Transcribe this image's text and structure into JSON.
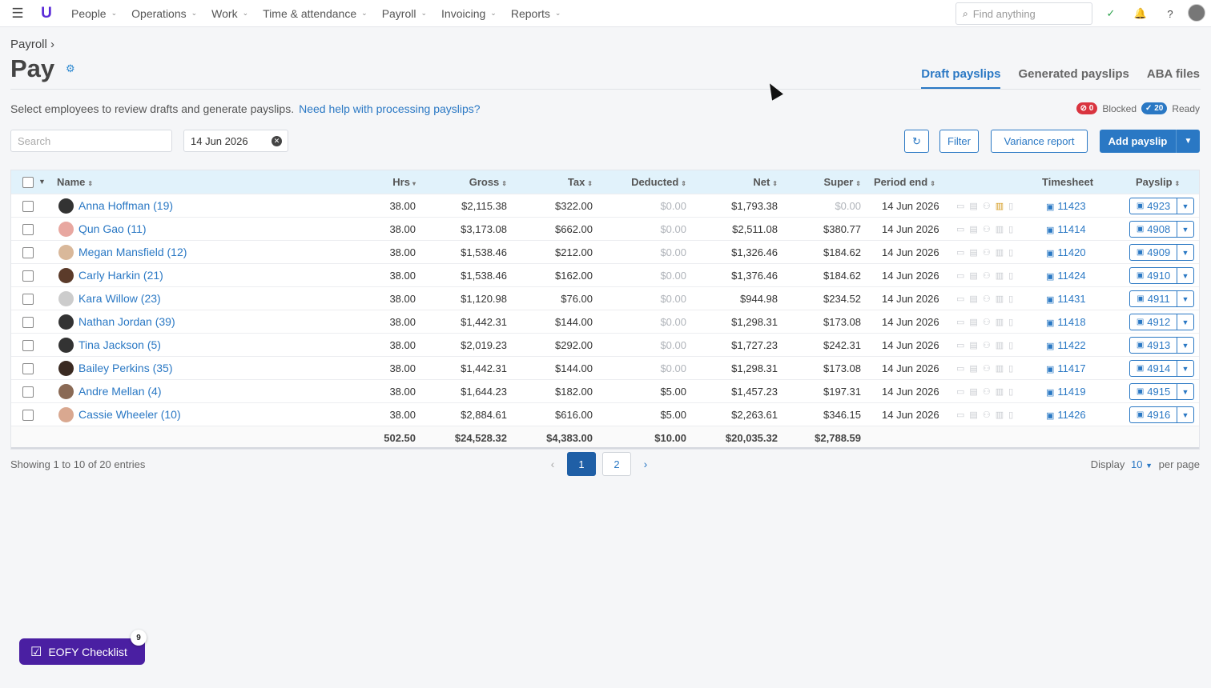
{
  "nav": {
    "items": [
      "People",
      "Operations",
      "Work",
      "Time & attendance",
      "Payroll",
      "Invoicing",
      "Reports"
    ],
    "search_placeholder": "Find anything"
  },
  "breadcrumb": "Payroll",
  "title": "Pay",
  "tabs": [
    "Draft payslips",
    "Generated payslips",
    "ABA files"
  ],
  "intro": "Select employees to review drafts and generate payslips.",
  "help_link": "Need help with processing payslips?",
  "status": {
    "blocked_count": "0",
    "blocked_label": "Blocked",
    "ready_count": "20",
    "ready_label": "Ready"
  },
  "toolbar": {
    "search_placeholder": "Search",
    "date": "14 Jun 2026",
    "filter": "Filter",
    "variance": "Variance report",
    "add": "Add payslip"
  },
  "columns": {
    "name": "Name",
    "hrs": "Hrs",
    "gross": "Gross",
    "tax": "Tax",
    "deducted": "Deducted",
    "net": "Net",
    "super": "Super",
    "period": "Period end",
    "timesheet": "Timesheet",
    "payslip": "Payslip"
  },
  "rows": [
    {
      "name": "Anna Hoffman (19)",
      "hrs": "38.00",
      "gross": "$2,115.38",
      "tax": "$322.00",
      "deducted": "$0.00",
      "net": "$1,793.38",
      "super": "$0.00",
      "period": "14 Jun 2026",
      "timesheet": "11423",
      "payslip": "4923"
    },
    {
      "name": "Qun Gao (11)",
      "hrs": "38.00",
      "gross": "$3,173.08",
      "tax": "$662.00",
      "deducted": "$0.00",
      "net": "$2,511.08",
      "super": "$380.77",
      "period": "14 Jun 2026",
      "timesheet": "11414",
      "payslip": "4908"
    },
    {
      "name": "Megan Mansfield (12)",
      "hrs": "38.00",
      "gross": "$1,538.46",
      "tax": "$212.00",
      "deducted": "$0.00",
      "net": "$1,326.46",
      "super": "$184.62",
      "period": "14 Jun 2026",
      "timesheet": "11420",
      "payslip": "4909"
    },
    {
      "name": "Carly Harkin (21)",
      "hrs": "38.00",
      "gross": "$1,538.46",
      "tax": "$162.00",
      "deducted": "$0.00",
      "net": "$1,376.46",
      "super": "$184.62",
      "period": "14 Jun 2026",
      "timesheet": "11424",
      "payslip": "4910"
    },
    {
      "name": "Kara Willow (23)",
      "hrs": "38.00",
      "gross": "$1,120.98",
      "tax": "$76.00",
      "deducted": "$0.00",
      "net": "$944.98",
      "super": "$234.52",
      "period": "14 Jun 2026",
      "timesheet": "11431",
      "payslip": "4911"
    },
    {
      "name": "Nathan Jordan (39)",
      "hrs": "38.00",
      "gross": "$1,442.31",
      "tax": "$144.00",
      "deducted": "$0.00",
      "net": "$1,298.31",
      "super": "$173.08",
      "period": "14 Jun 2026",
      "timesheet": "11418",
      "payslip": "4912"
    },
    {
      "name": "Tina Jackson (5)",
      "hrs": "38.00",
      "gross": "$2,019.23",
      "tax": "$292.00",
      "deducted": "$0.00",
      "net": "$1,727.23",
      "super": "$242.31",
      "period": "14 Jun 2026",
      "timesheet": "11422",
      "payslip": "4913"
    },
    {
      "name": "Bailey Perkins (35)",
      "hrs": "38.00",
      "gross": "$1,442.31",
      "tax": "$144.00",
      "deducted": "$0.00",
      "net": "$1,298.31",
      "super": "$173.08",
      "period": "14 Jun 2026",
      "timesheet": "11417",
      "payslip": "4914"
    },
    {
      "name": "Andre Mellan (4)",
      "hrs": "38.00",
      "gross": "$1,644.23",
      "tax": "$182.00",
      "deducted": "$5.00",
      "net": "$1,457.23",
      "super": "$197.31",
      "period": "14 Jun 2026",
      "timesheet": "11419",
      "payslip": "4915"
    },
    {
      "name": "Cassie Wheeler (10)",
      "hrs": "38.00",
      "gross": "$2,884.61",
      "tax": "$616.00",
      "deducted": "$5.00",
      "net": "$2,263.61",
      "super": "$346.15",
      "period": "14 Jun 2026",
      "timesheet": "11426",
      "payslip": "4916"
    }
  ],
  "totals": {
    "hrs": "502.50",
    "gross": "$24,528.32",
    "tax": "$4,383.00",
    "deducted": "$10.00",
    "net": "$20,035.32",
    "super": "$2,788.59"
  },
  "pagination": {
    "showing": "Showing 1 to 10 of 20 entries",
    "pages": [
      "1",
      "2"
    ],
    "display_label": "Display",
    "per_page_value": "10",
    "per_page_suffix": "per page"
  },
  "eofy": {
    "label": "EOFY Checklist",
    "badge": "9"
  },
  "colors": {
    "accent": "#2a78c4",
    "header_bg": "#e1f2fb",
    "eofy": "#4a1fa2",
    "blocked": "#d9343f"
  }
}
